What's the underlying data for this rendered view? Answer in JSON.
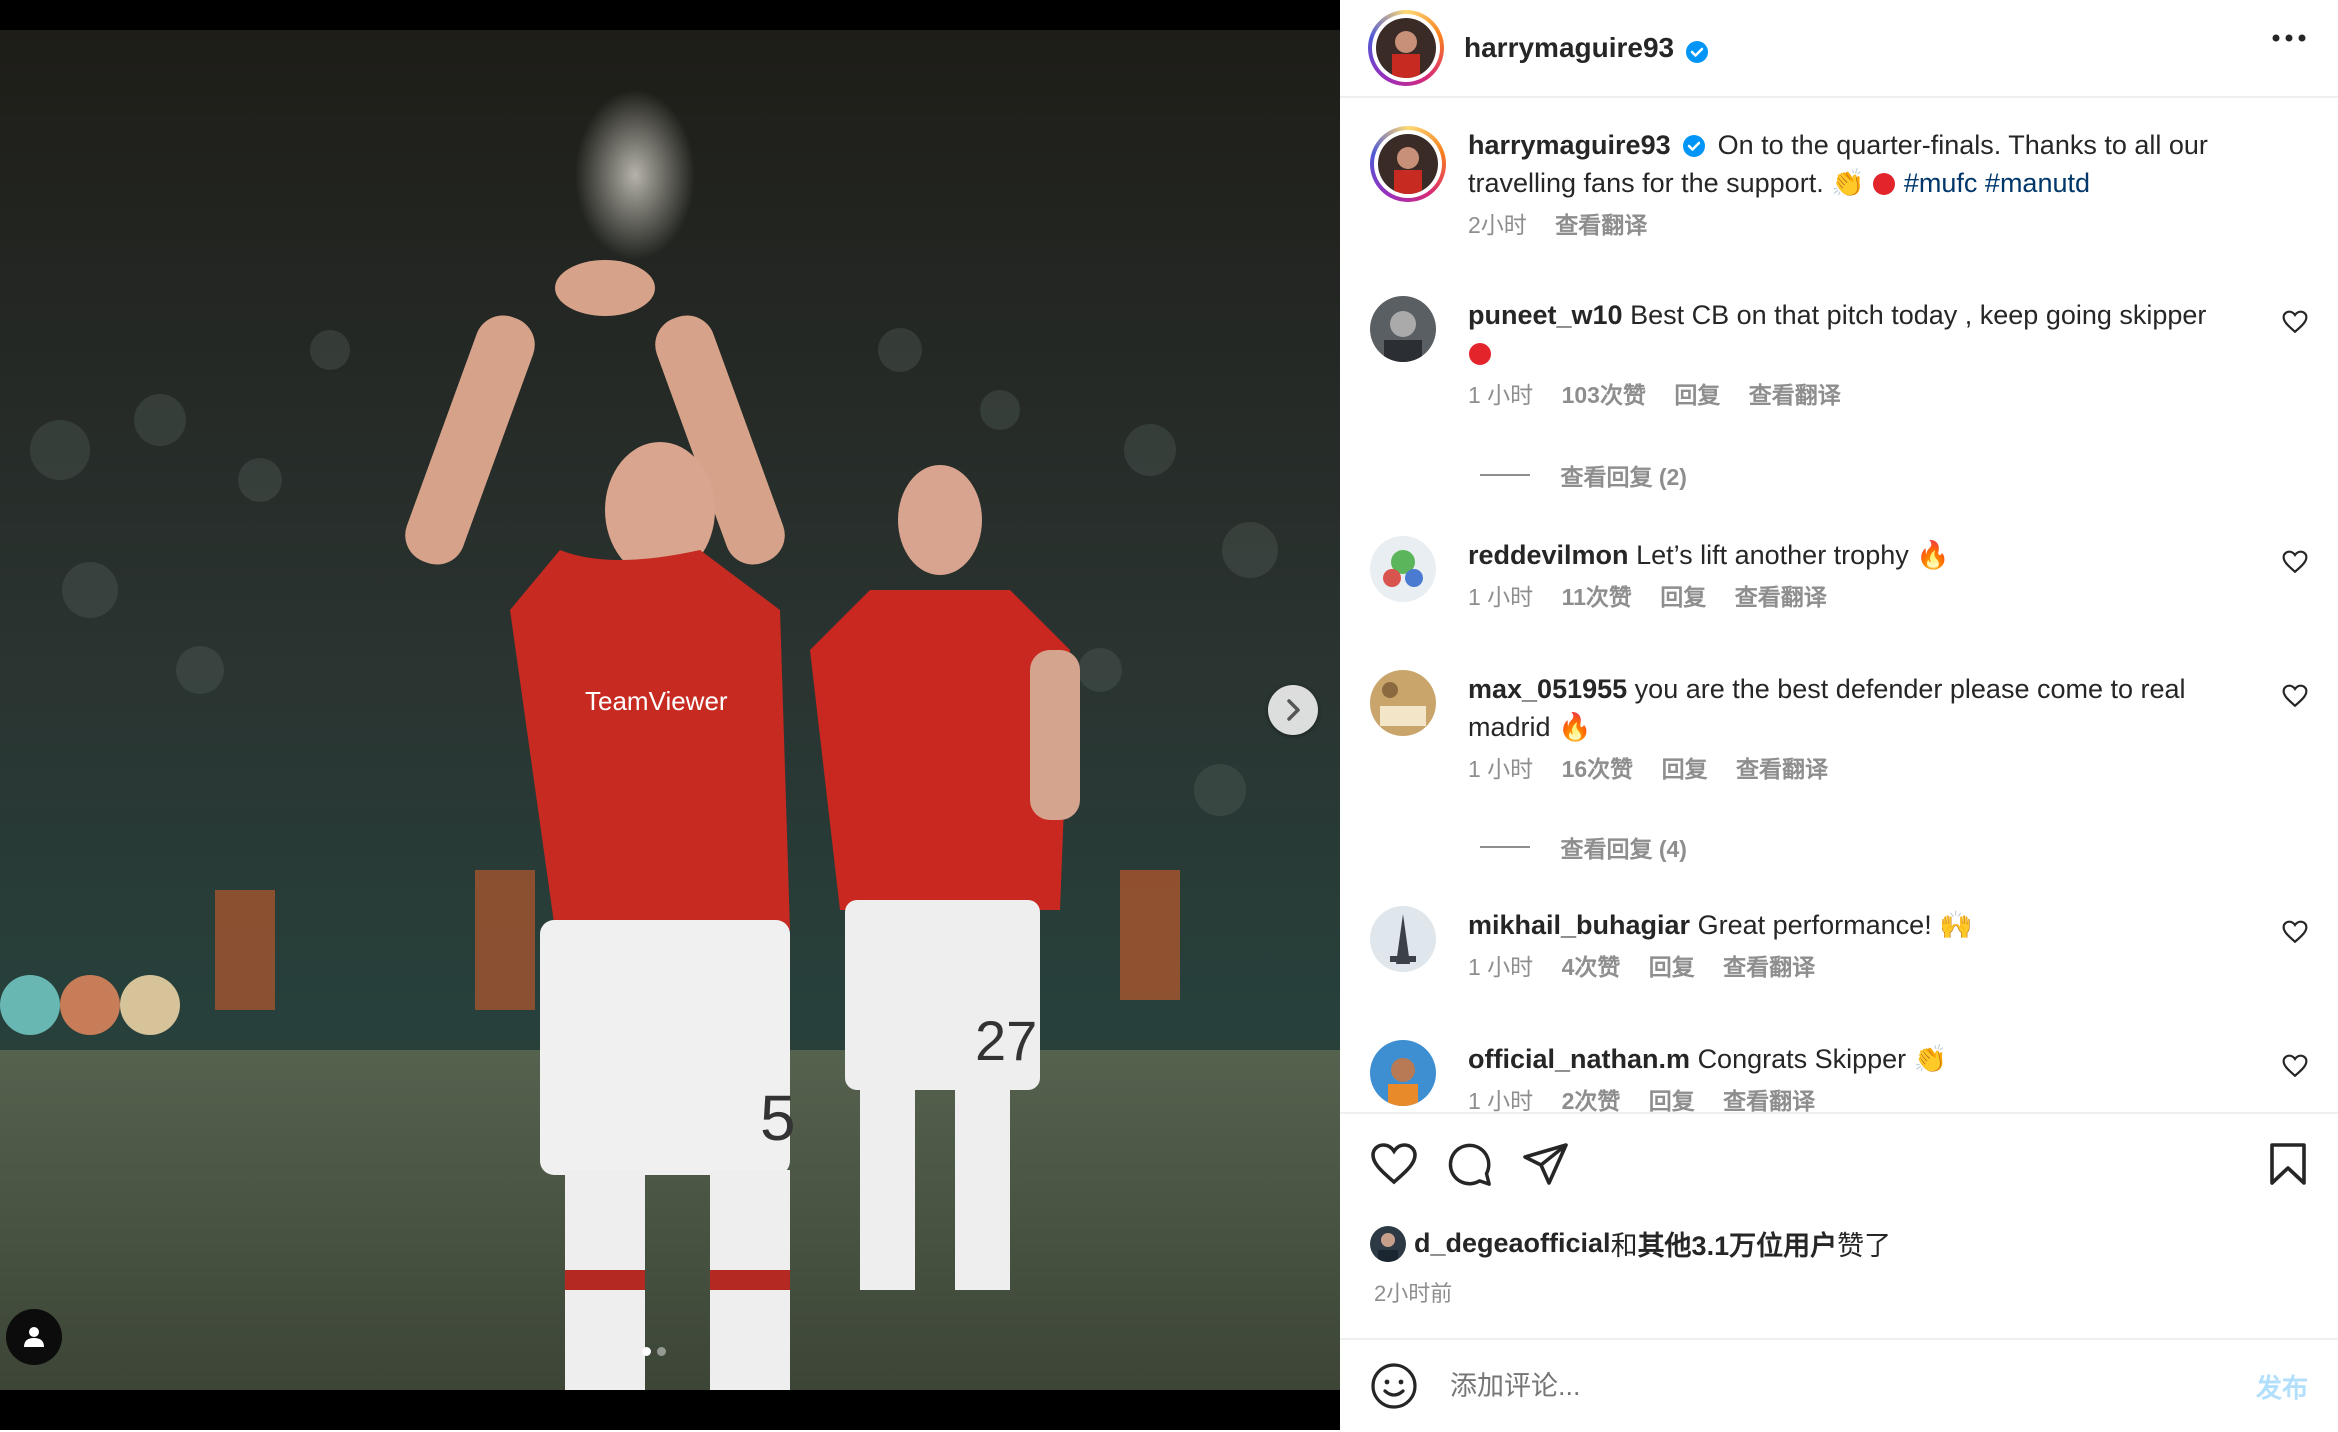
{
  "post": {
    "author": "harrymaguire93",
    "verified": true,
    "caption": "On to the quarter-finals. Thanks to all our travelling fans for the support.",
    "caption_emoji": [
      "clapping-hands",
      "red-circle"
    ],
    "hashtags": [
      "#mufc",
      "#manutd"
    ],
    "time": "2小时",
    "translate": "查看翻译"
  },
  "media": {
    "image_description": "Two Manchester United players in red home kits (numbers 5 and 27) applauding fans on the pitch at night",
    "carousel_count": 2,
    "carousel_index": 0
  },
  "comments": [
    {
      "user": "puneet_w10",
      "text": "Best CB on that pitch today , keep going skipper",
      "emoji": "red-circle",
      "time": "1 小时",
      "likes": "103次赞",
      "reply": "回复",
      "translate": "查看翻译",
      "view_replies": "查看回复 (2)"
    },
    {
      "user": "reddevilmon",
      "text": "Let’s lift another trophy",
      "emoji": "fire",
      "time": "1 小时",
      "likes": "11次赞",
      "reply": "回复",
      "translate": "查看翻译"
    },
    {
      "user": "max_051955",
      "text": "you are the best defender please come to real madrid",
      "emoji": "fire",
      "time": "1 小时",
      "likes": "16次赞",
      "reply": "回复",
      "translate": "查看翻译",
      "view_replies": "查看回复 (4)"
    },
    {
      "user": "mikhail_buhagiar",
      "text": "Great performance!",
      "emoji": "raising-hands",
      "time": "1 小时",
      "likes": "4次赞",
      "reply": "回复",
      "translate": "查看翻译"
    },
    {
      "user": "official_nathan.m",
      "text": "Congrats Skipper",
      "emoji": "clapping-hands-brown",
      "time": "1 小时",
      "likes": "2次赞",
      "reply": "回复",
      "translate": "查看翻译"
    }
  ],
  "likes": {
    "user": "d_degeaofficial",
    "mid": "和",
    "others": "其他3.1万位用户",
    "suffix": "赞了"
  },
  "posted_ago": "2小时前",
  "comment_input": {
    "placeholder": "添加评论..."
  },
  "post_button": "发布",
  "colors": {
    "accent": "#0095f6",
    "verified": "#0095f6",
    "hashtag": "#00376b",
    "muted": "#8e8e8e"
  }
}
